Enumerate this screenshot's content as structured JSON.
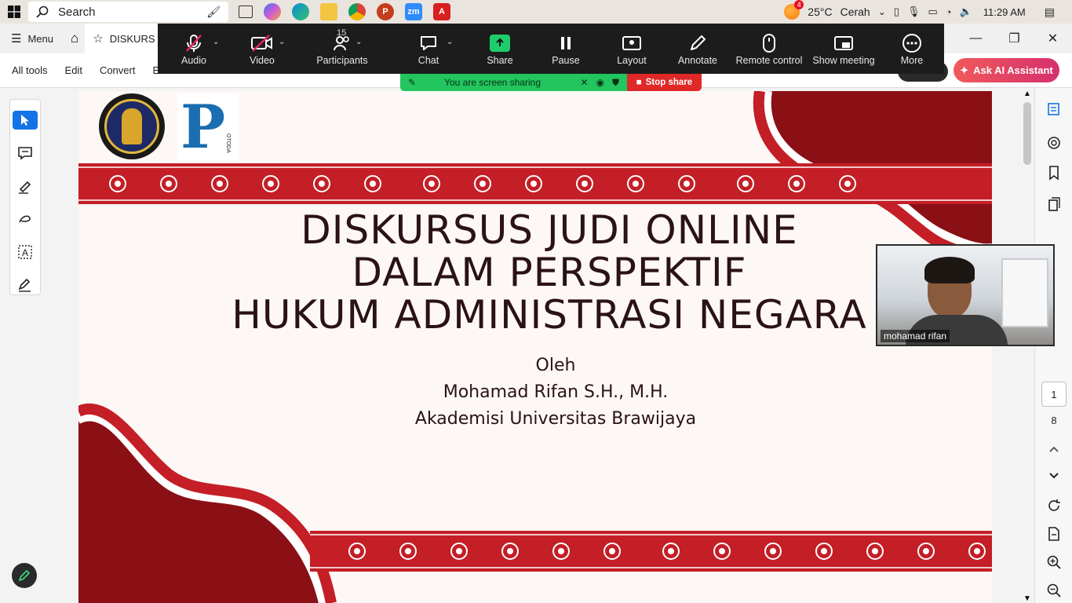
{
  "taskbar": {
    "search_label": "Search",
    "weather": {
      "badge": "4",
      "temp": "25°C",
      "condition": "Cerah"
    },
    "clock": "11:29 AM",
    "apps": [
      "file-explorer-icon",
      "copilot-icon",
      "edge-icon",
      "folder-icon",
      "chrome-icon",
      "powerpoint-icon",
      "zoom-icon",
      "acrobat-icon"
    ]
  },
  "tabs": {
    "menu_label": "Menu",
    "doc_tab_label": "DISKURS"
  },
  "toolbar": {
    "items": [
      "All tools",
      "Edit",
      "Convert",
      "E"
    ],
    "ai_label": "Ask AI Assistant"
  },
  "zoom": {
    "buttons": [
      {
        "label": "Audio"
      },
      {
        "label": "Video"
      },
      {
        "label": "Participants"
      },
      {
        "label": "Chat"
      },
      {
        "label": "Share"
      },
      {
        "label": "Pause"
      },
      {
        "label": "Layout"
      },
      {
        "label": "Annotate"
      },
      {
        "label": "Remote control"
      },
      {
        "label": "Show meeting"
      },
      {
        "label": "More"
      }
    ],
    "participant_count": "15",
    "sharing_text": "You are screen sharing",
    "stop_share_label": "Stop share"
  },
  "slide": {
    "title_lines": [
      "DISKURSUS JUDI ONLINE",
      "DALAM PERSPEKTIF",
      "HUKUM ADMINISTRASI NEGARA"
    ],
    "subtitle_lines": [
      "Oleh",
      "Mohamad Rifan S.H., M.H.",
      "Akademisi Universitas Brawijaya"
    ],
    "logo_text": "P",
    "logo_side_text": "OTODA",
    "colors": {
      "red": "#c41e26",
      "dark_red": "#8a1016",
      "cream": "#fdf8f5",
      "text": "#2a1215"
    }
  },
  "pager": {
    "current": "1",
    "total": "8"
  },
  "video": {
    "name": "mohamad rifan"
  }
}
